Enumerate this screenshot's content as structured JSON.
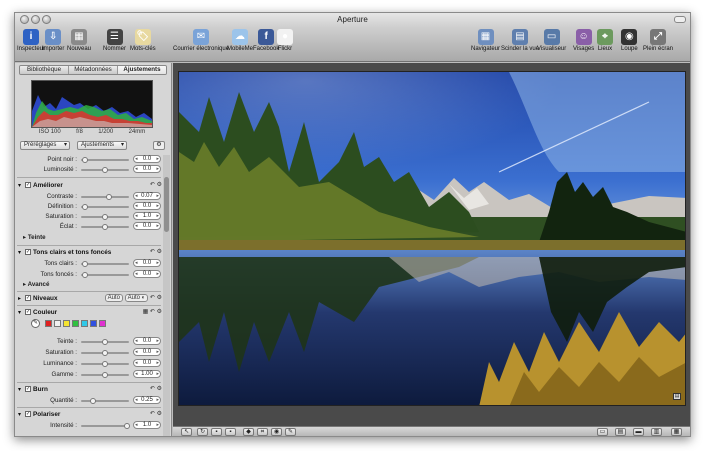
{
  "window": {
    "title": "Aperture"
  },
  "toolbar": {
    "left": [
      {
        "label": "Inspecteur",
        "icon": "info-icon",
        "color": "#2e62c4"
      },
      {
        "label": "Importer",
        "icon": "import-icon",
        "color": "#6a8fc7"
      },
      {
        "label": "Nouveau",
        "icon": "new-icon",
        "color": "#8a8a8a"
      },
      {
        "label": "Nommer",
        "icon": "name-icon",
        "color": "#444444"
      },
      {
        "label": "Mots-clés",
        "icon": "keyword-icon",
        "color": "#e8d9a0"
      }
    ],
    "center": [
      {
        "label": "Courrier électronique",
        "icon": "mail-icon",
        "color": "#7aa3d8"
      },
      {
        "label": "MobileMe",
        "icon": "mobileme-icon",
        "color": "#9cc4ea"
      },
      {
        "label": "Facebook",
        "icon": "facebook-icon",
        "color": "#3b5998"
      },
      {
        "label": "Flickr",
        "icon": "flickr-icon",
        "color": "#f2f2f2"
      }
    ],
    "right": [
      {
        "label": "Navigateur",
        "icon": "browser-icon",
        "color": "#6f8fbf"
      },
      {
        "label": "Scinder la vue",
        "icon": "split-view-icon",
        "color": "#5f7fae"
      },
      {
        "label": "Visualiseur",
        "icon": "viewer-icon",
        "color": "#587aa8"
      },
      {
        "label": "Visages",
        "icon": "faces-icon",
        "color": "#8a5fa8"
      },
      {
        "label": "Lieux",
        "icon": "places-icon",
        "color": "#6c9a5e"
      },
      {
        "label": "Loupe",
        "icon": "loupe-icon",
        "color": "#333333"
      },
      {
        "label": "Plein écran",
        "icon": "fullscreen-icon",
        "color": "#777777"
      }
    ]
  },
  "inspector": {
    "tabs": [
      "Bibliothèque",
      "Métadonnées",
      "Ajustements"
    ],
    "active_tab": "Ajustements",
    "exif": {
      "iso": "ISO 100",
      "aperture": "f/8",
      "shutter": "1/200",
      "focal": "24mm"
    },
    "presets": "Préréglages",
    "adjustments": "Ajustements",
    "levels_auto": "Auto",
    "levels_auto2": "Auto ◐",
    "sections": {
      "ameliorer": "Améliorer",
      "teinte": "Teinte",
      "tons": "Tons clairs et tons foncés",
      "avance": "Avancé",
      "niveaux": "Niveaux",
      "couleur": "Couleur",
      "burn": "Burn",
      "polariser": "Polariser"
    },
    "sliders": [
      {
        "label": "Point noir :",
        "value": "0.0",
        "pos": 0.08
      },
      {
        "label": "Luminosité :",
        "value": "0.0",
        "pos": 0.5
      },
      {
        "label": "Contraste :",
        "value": "0.07",
        "pos": 0.58
      },
      {
        "label": "Définition :",
        "value": "0.0",
        "pos": 0.08
      },
      {
        "label": "Saturation :",
        "value": "1.0",
        "pos": 0.5
      },
      {
        "label": "Éclat :",
        "value": "0.0",
        "pos": 0.5
      },
      {
        "label": "Tons clairs :",
        "value": "0.0",
        "pos": 0.08
      },
      {
        "label": "Tons foncés :",
        "value": "0.0",
        "pos": 0.08
      },
      {
        "label": "Teinte :",
        "value": "0.0",
        "pos": 0.5
      },
      {
        "label": "Saturation :",
        "value": "0.0",
        "pos": 0.5
      },
      {
        "label": "Luminance :",
        "value": "0.0",
        "pos": 0.5
      },
      {
        "label": "Gamme :",
        "value": "1.00",
        "pos": 0.5
      },
      {
        "label": "Quantité :",
        "value": "0.25",
        "pos": 0.25
      },
      {
        "label": "Intensité :",
        "value": "1.0",
        "pos": 0.95
      }
    ],
    "swatches": [
      "#e02020",
      "#f0f0f0",
      "#f5e330",
      "#30c040",
      "#30c8e8",
      "#3050e0",
      "#e030d0"
    ]
  },
  "colors": {
    "sidebar": "#d6d6d6",
    "viewer": "#4a4a4a",
    "accent": "#3a6ec8"
  }
}
